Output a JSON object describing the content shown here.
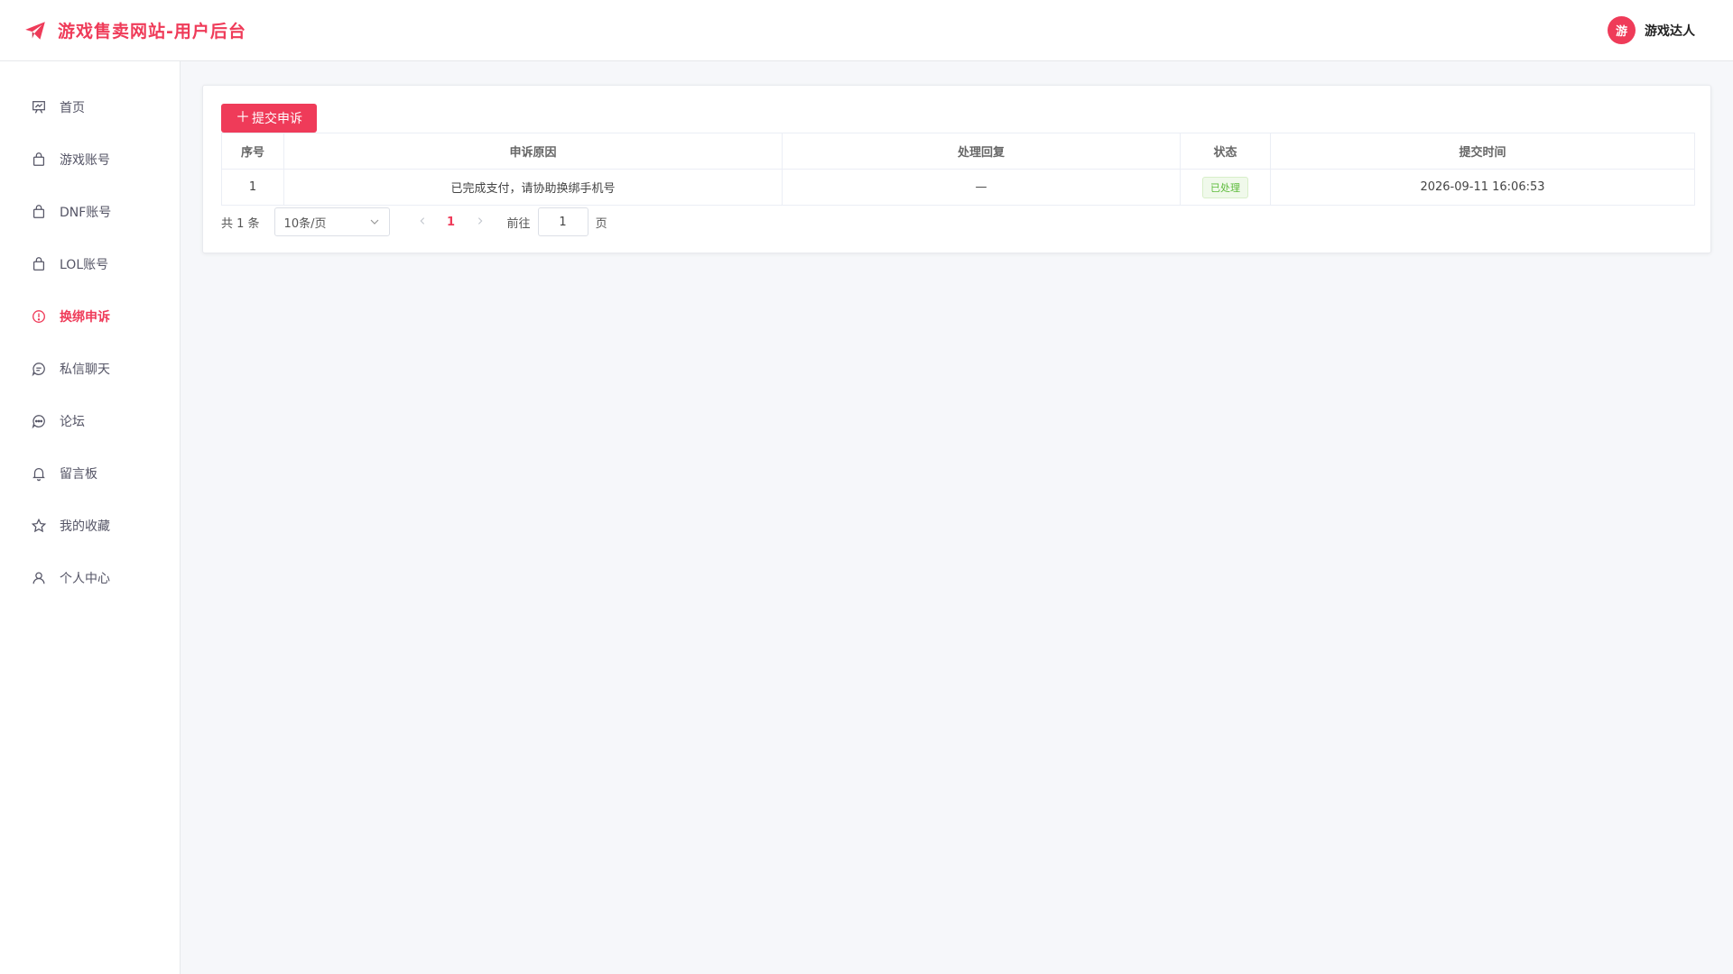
{
  "header": {
    "title": "游戏售卖网站-用户后台",
    "logo_icon": "paper-plane-icon",
    "user": {
      "avatar_text": "游",
      "name": "游戏达人"
    }
  },
  "sidebar": {
    "items": [
      {
        "label": "首页",
        "icon": "presentation-icon"
      },
      {
        "label": "游戏账号",
        "icon": "shopping-bag-icon"
      },
      {
        "label": "DNF账号",
        "icon": "shopping-bag-icon"
      },
      {
        "label": "LOL账号",
        "icon": "shopping-bag-icon"
      },
      {
        "label": "换绑申诉",
        "icon": "warning-circle-icon",
        "active": true
      },
      {
        "label": "私信聊天",
        "icon": "chat-icon"
      },
      {
        "label": "论坛",
        "icon": "chat-dots-icon"
      },
      {
        "label": "留言板",
        "icon": "bell-icon"
      },
      {
        "label": "我的收藏",
        "icon": "star-icon"
      },
      {
        "label": "个人中心",
        "icon": "user-icon"
      }
    ]
  },
  "toolbar": {
    "submit_label": "提交申诉"
  },
  "table": {
    "columns": [
      "序号",
      "申诉原因",
      "处理回复",
      "状态",
      "提交时间"
    ],
    "rows": [
      {
        "index": "1",
        "reason": "已完成支付，请协助换绑手机号",
        "reply": "—",
        "status": "已处理",
        "time": "2026-09-11 16:06:53"
      }
    ]
  },
  "pagination": {
    "total_text": "共 1 条",
    "page_size": "10条/页",
    "current_page": "1",
    "goto_label": "前往",
    "goto_value": "1",
    "page_suffix": "页"
  },
  "colors": {
    "accent": "#ef3b59",
    "success": "#5dbb3b"
  }
}
